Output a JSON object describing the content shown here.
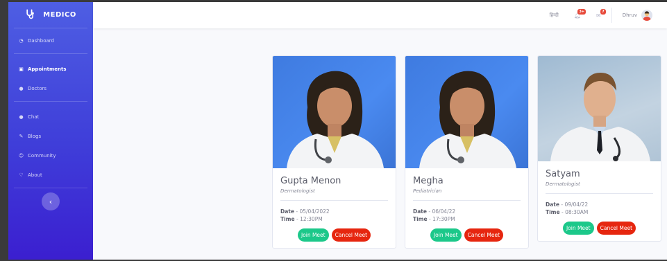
{
  "brand": {
    "name": "MEDICO"
  },
  "sidebar": {
    "items": [
      {
        "label": "Dashboard",
        "icon": "dashboard-icon"
      },
      {
        "label": "Appointments",
        "icon": "calendar-icon",
        "active": true
      },
      {
        "label": "Doctors",
        "icon": "doctor-icon"
      },
      {
        "label": "Chat",
        "icon": "chat-icon"
      },
      {
        "label": "Blogs",
        "icon": "blog-icon"
      },
      {
        "label": "Community",
        "icon": "community-icon"
      },
      {
        "label": "About",
        "icon": "about-icon"
      }
    ],
    "toggle_label": "‹"
  },
  "topbar": {
    "language": "हिन्दी",
    "alerts_badge": "3+",
    "messages_badge": "7",
    "username": "Dhruv"
  },
  "appointments": [
    {
      "name": "Gupta Menon",
      "specialty": "Dermatologist",
      "date_label": "Date",
      "date": "05/04/2022",
      "time_label": "Time",
      "time": "12:30PM",
      "join_label": "Join Meet",
      "cancel_label": "Cancel Meet"
    },
    {
      "name": "Megha",
      "specialty": "Pediatrician",
      "date_label": "Date",
      "date": "06/04/22",
      "time_label": "Time",
      "time": "17:30PM",
      "join_label": "Join Meet",
      "cancel_label": "Cancel Meet"
    },
    {
      "name": "Satyam",
      "specialty": "Dermatologist",
      "date_label": "Date",
      "date": "09/04/22",
      "time_label": "Time",
      "time": "08:30AM",
      "join_label": "Join Meet",
      "cancel_label": "Cancel Meet"
    }
  ],
  "colors": {
    "sidebar_top": "#4e5ee3",
    "sidebar_bottom": "#3b1fd0",
    "join": "#1cc88a",
    "cancel": "#e6260f",
    "badge": "#e74a3b"
  }
}
